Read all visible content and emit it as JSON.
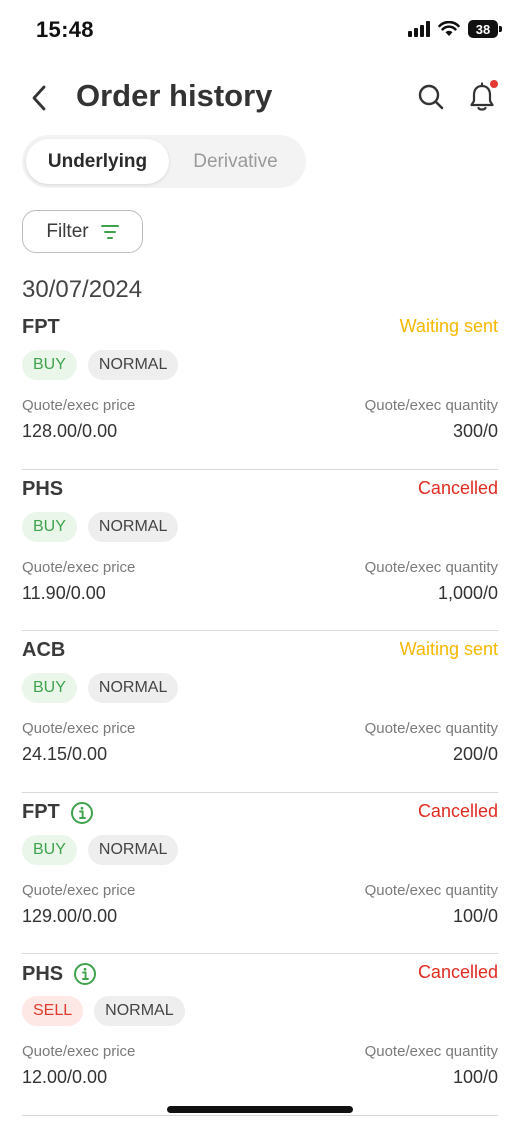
{
  "status_bar": {
    "time": "15:48",
    "battery": "38"
  },
  "header": {
    "title": "Order history",
    "back_icon": "chevron-left-icon",
    "search_icon": "search-icon",
    "bell_icon": "bell-icon"
  },
  "tabs": [
    {
      "label": "Underlying",
      "active": true
    },
    {
      "label": "Derivative",
      "active": false
    }
  ],
  "filter": {
    "label": "Filter"
  },
  "date": "30/07/2024",
  "labels": {
    "price": "Quote/exec price",
    "quantity": "Quote/exec quantity"
  },
  "colors": {
    "waiting": "#f5b800",
    "cancelled": "#e02b20",
    "buy": "#3fa34d",
    "sell": "#e0392d",
    "notification_dot": "#e53935"
  },
  "orders": [
    {
      "symbol": "FPT",
      "info": false,
      "status": "Waiting sent",
      "status_type": "waiting",
      "side": "BUY",
      "type": "NORMAL",
      "price": "128.00/0.00",
      "quantity": "300/0"
    },
    {
      "symbol": "PHS",
      "info": false,
      "status": "Cancelled",
      "status_type": "cancelled",
      "side": "BUY",
      "type": "NORMAL",
      "price": "11.90/0.00",
      "quantity": "1,000/0"
    },
    {
      "symbol": "ACB",
      "info": false,
      "status": "Waiting sent",
      "status_type": "waiting",
      "side": "BUY",
      "type": "NORMAL",
      "price": "24.15/0.00",
      "quantity": "200/0"
    },
    {
      "symbol": "FPT",
      "info": true,
      "status": "Cancelled",
      "status_type": "cancelled",
      "side": "BUY",
      "type": "NORMAL",
      "price": "129.00/0.00",
      "quantity": "100/0"
    },
    {
      "symbol": "PHS",
      "info": true,
      "status": "Cancelled",
      "status_type": "cancelled",
      "side": "SELL",
      "type": "NORMAL",
      "price": "12.00/0.00",
      "quantity": "100/0"
    }
  ]
}
